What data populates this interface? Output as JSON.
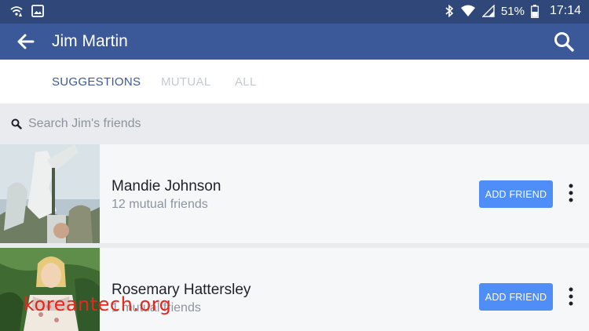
{
  "status_bar": {
    "battery": "51%",
    "time": "17:14"
  },
  "app_bar": {
    "title": "Jim Martin"
  },
  "tabs": [
    {
      "label": "SUGGESTIONS",
      "active": true
    },
    {
      "label": "MUTUAL",
      "active": false
    },
    {
      "label": "ALL",
      "active": false
    }
  ],
  "search": {
    "placeholder": "Search Jim's friends"
  },
  "friends": [
    {
      "name": "Mandie Johnson",
      "mutual": "12 mutual friends",
      "button": "ADD FRIEND"
    },
    {
      "name": "Rosemary Hattersley",
      "mutual": "1 mutual friends",
      "button": "ADD FRIEND"
    }
  ],
  "watermark": "koreantech.org",
  "colors": {
    "status_bar": "#2f4779",
    "app_bar": "#3b5998",
    "button": "#4f8ef7",
    "watermark": "#e8261d"
  }
}
